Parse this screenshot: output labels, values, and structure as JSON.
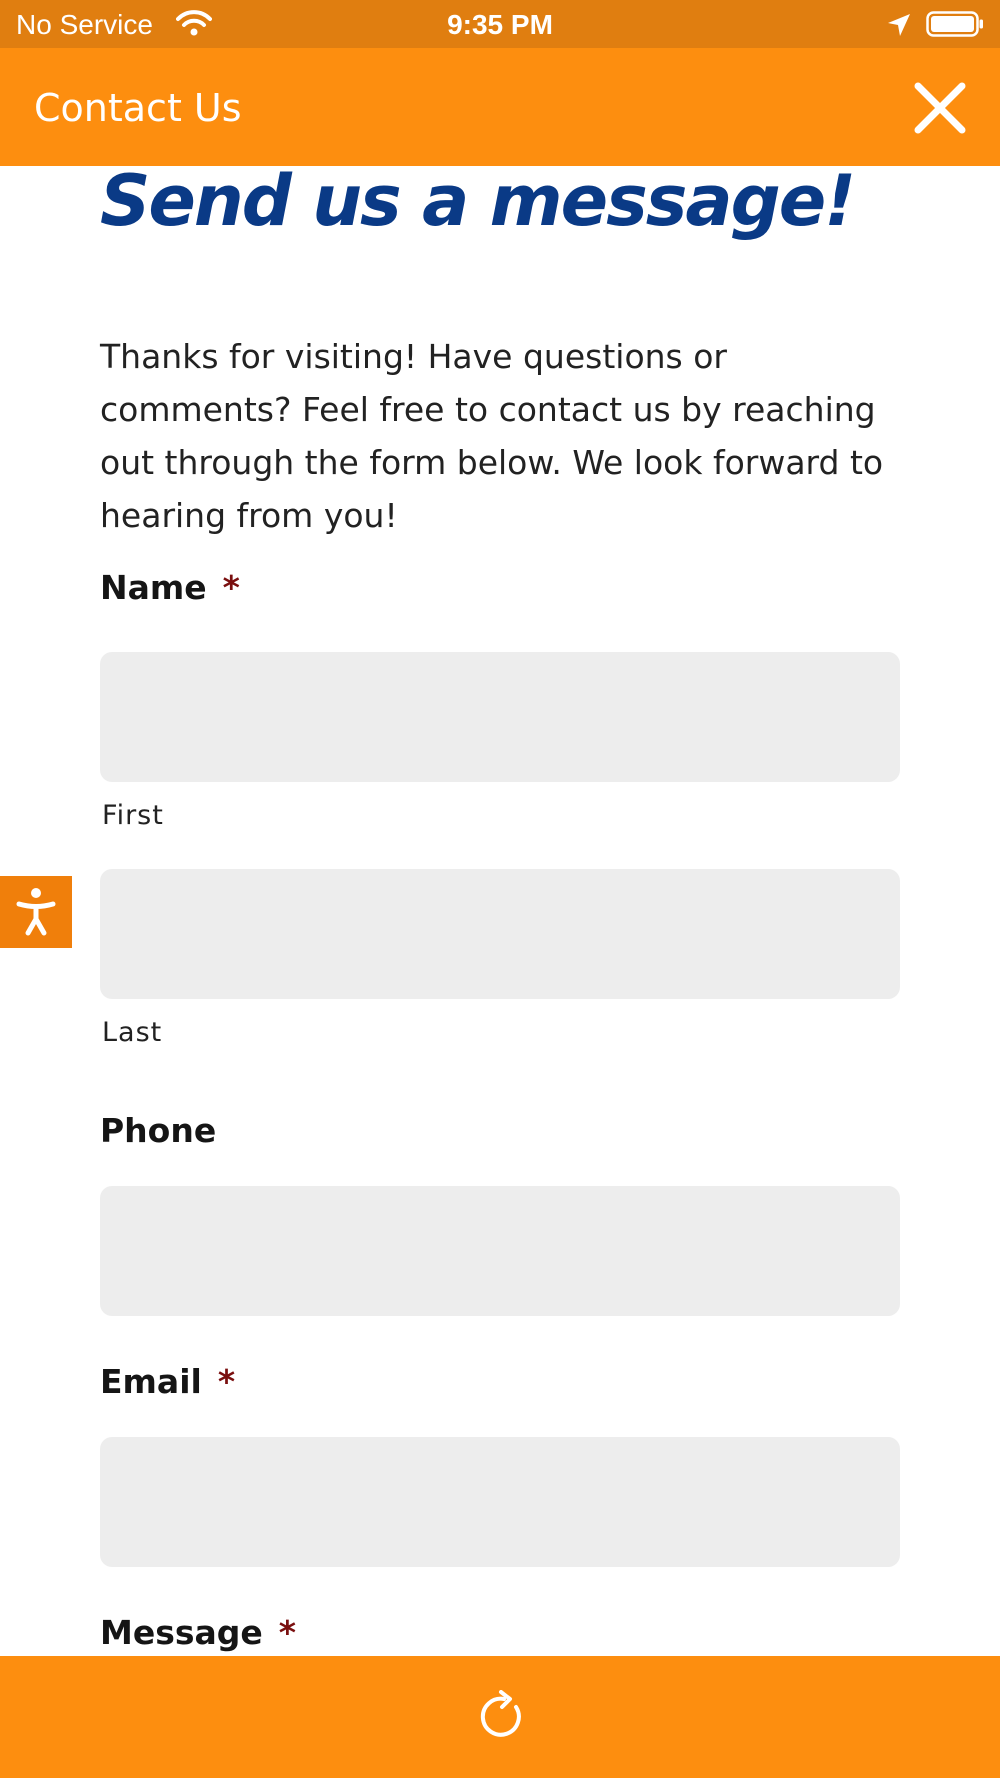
{
  "status_bar": {
    "carrier": "No Service",
    "time": "9:35 PM",
    "icons": [
      "wifi-icon",
      "location-arrow-icon",
      "battery-icon"
    ]
  },
  "nav_bar": {
    "title": "Contact Us",
    "close_icon": "close-icon"
  },
  "page": {
    "heading": "Send us a message!",
    "intro": "Thanks for visiting! Have questions or comments? Feel free to contact us by reaching out through the form below. We look forward to hearing from you!"
  },
  "form": {
    "required_marker": "*",
    "name": {
      "label": "Name",
      "first_label": "First",
      "first_value": "",
      "last_label": "Last",
      "last_value": ""
    },
    "phone": {
      "label": "Phone",
      "value": ""
    },
    "email": {
      "label": "Email",
      "value": ""
    },
    "message": {
      "label": "Message"
    }
  },
  "accessibility_button_icon": "accessibility-person-icon",
  "bottom_bar": {
    "refresh_icon": "refresh-icon"
  },
  "colors": {
    "status_bar": "#e07e10",
    "nav_bar": "#fd8e0f",
    "heading": "#0a3a86",
    "required": "#7a0f0f",
    "field_bg": "#ededed",
    "accessibility_button": "#f07f0b"
  }
}
